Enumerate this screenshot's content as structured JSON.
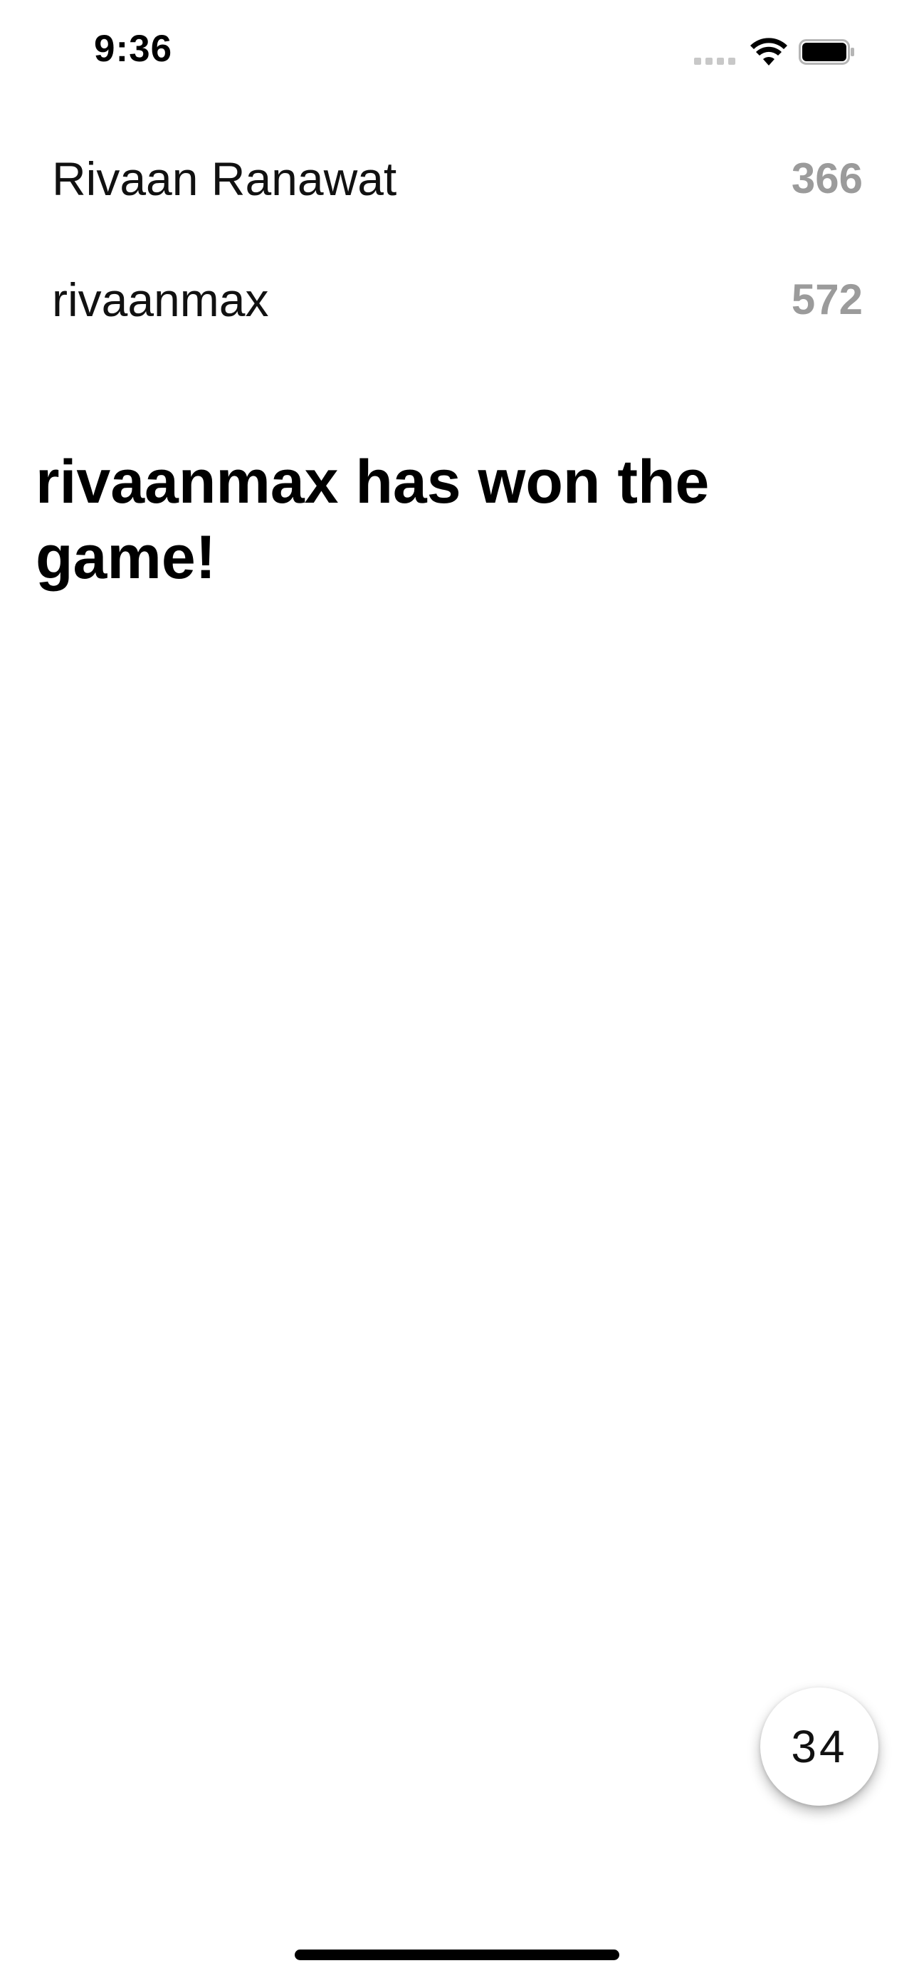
{
  "status_bar": {
    "time": "9:36"
  },
  "players": [
    {
      "name": "Rivaan Ranawat",
      "score": "366"
    },
    {
      "name": "rivaanmax",
      "score": "572"
    }
  ],
  "winner_message": "rivaanmax has won the game!",
  "fab": {
    "label": "34"
  },
  "colors": {
    "background": "#ffffff",
    "score_gray": "#9b9b9b",
    "text": "#000000"
  },
  "icons": {
    "signal": "cellular-signal-icon",
    "wifi": "wifi-icon",
    "battery": "battery-icon"
  }
}
